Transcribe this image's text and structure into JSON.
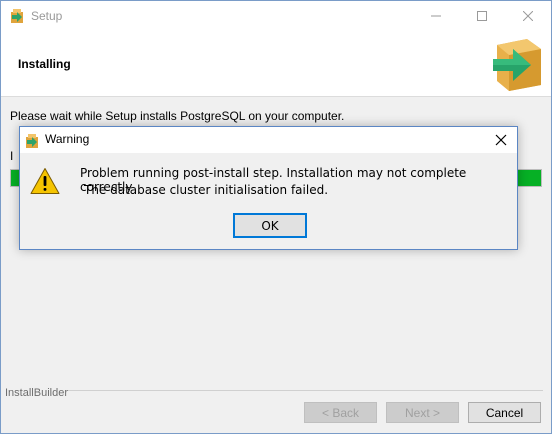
{
  "window": {
    "title": "Setup",
    "controls": {
      "minimize": "minimize-icon",
      "maximize": "maximize-icon",
      "close": "close-icon"
    }
  },
  "header": {
    "title": "Installing",
    "logo_icon": "install-arrow-box-icon"
  },
  "main": {
    "message": "Please wait while Setup installs PostgreSQL on your computer.",
    "status_label_partial": "I",
    "progress_percent": 100,
    "progress_color": "#06b025"
  },
  "footer": {
    "brand": "InstallBuilder",
    "back_label": "< Back",
    "next_label": "Next >",
    "cancel_label": "Cancel"
  },
  "dialog": {
    "title": "Warning",
    "icon": "warning-triangle-icon",
    "message_line1": "Problem running post-install step. Installation may not complete correctly",
    "message_line2": "The database cluster initialisation failed.",
    "ok_label": "OK"
  },
  "colors": {
    "accent": "#0078d7",
    "warning": "#f5c400",
    "logo_green": "#27a46a",
    "logo_box": "#e8b04a"
  }
}
